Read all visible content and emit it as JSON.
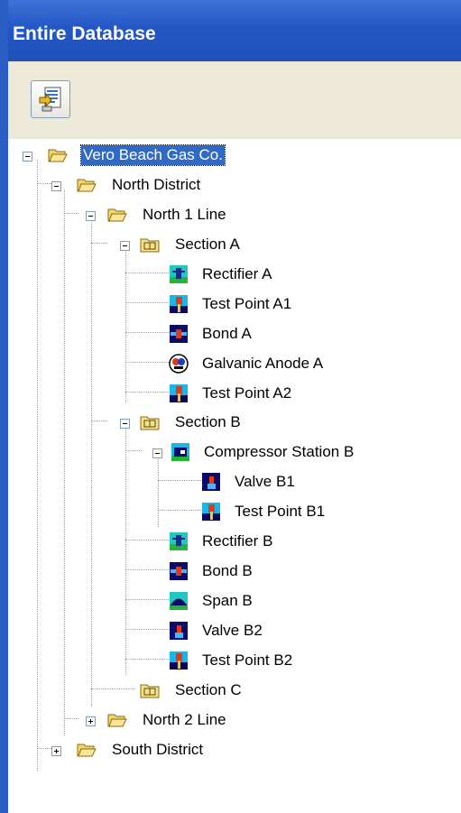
{
  "panel": {
    "title": "Entire Database"
  },
  "toolbar": {
    "report_icon": "report-icon"
  },
  "tree": {
    "root": "Vero Beach Gas Co.",
    "north_district": "North District",
    "north_1_line": "North 1 Line",
    "section_a": "Section A",
    "rectifier_a": "Rectifier A",
    "test_point_a1": "Test Point A1",
    "bond_a": "Bond A",
    "galvanic_anode_a": "Galvanic Anode A",
    "test_point_a2": "Test Point A2",
    "section_b": "Section B",
    "compressor_station_b": "Compressor Station B",
    "valve_b1": "Valve B1",
    "test_point_b1": "Test Point B1",
    "rectifier_b": "Rectifier B",
    "bond_b": "Bond B",
    "span_b": "Span B",
    "valve_b2": "Valve B2",
    "test_point_b2": "Test Point B2",
    "section_c": "Section C",
    "north_2_line": "North 2 Line",
    "south_district": "South District"
  },
  "colors": {
    "title_bar": "#2457c5",
    "selection": "#316ac5",
    "toolbar": "#ece9d8"
  }
}
